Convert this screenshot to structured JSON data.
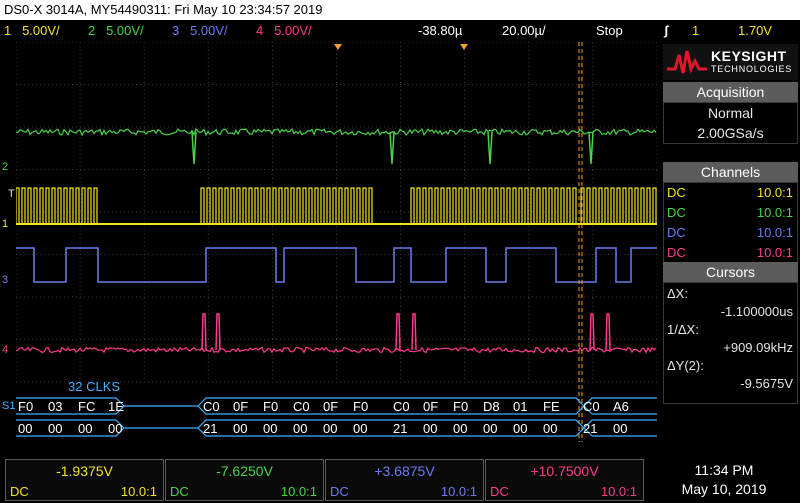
{
  "title": "DS0-X 3014A, MY54490311: Fri May 10 23:34:57 2019",
  "status": {
    "ch1": {
      "num": "1",
      "scale": "5.00V/"
    },
    "ch2": {
      "num": "2",
      "scale": "5.00V/"
    },
    "ch3": {
      "num": "3",
      "scale": "5.00V/"
    },
    "ch4": {
      "num": "4",
      "scale": "5.00V/"
    },
    "delay": "-38.80µ",
    "timebase": "20.00µ/",
    "run_state": "Stop",
    "trigger_icon": "rising-edge-trigger-icon",
    "trigger_source": "1",
    "trigger_level": "1.70V"
  },
  "brand": {
    "name": "KEYSIGHT",
    "sub": "TECHNOLOGIES"
  },
  "acquisition": {
    "header": "Acquisition",
    "mode": "Normal",
    "rate": "2.00GSa/s"
  },
  "channels": {
    "header": "Channels",
    "rows": [
      {
        "coupling": "DC",
        "probe": "10.0:1",
        "color": "#f2e321"
      },
      {
        "coupling": "DC",
        "probe": "10.0:1",
        "color": "#4ad44a"
      },
      {
        "coupling": "DC",
        "probe": "10.0:1",
        "color": "#6b7cf0"
      },
      {
        "coupling": "DC",
        "probe": "10.0:1",
        "color": "#ff3a8c"
      }
    ]
  },
  "cursors": {
    "header": "Cursors",
    "dx_label": "ΔX:",
    "dx_value": "-1.100000us",
    "inv_label": "1/ΔX:",
    "inv_value": "+909.09kHz",
    "dy_label": "ΔY(2):",
    "dy_value": "-9.5675V"
  },
  "plot": {
    "ch_markers": [
      "2",
      "1",
      "3",
      "4"
    ],
    "trigger_marker": "T",
    "serial_marker": "S1",
    "clks_label": "32  CLKS",
    "serial_row1": [
      "F0",
      "03",
      "FC",
      "1E",
      "C0",
      "0F",
      "F0",
      "C0",
      "0F",
      "F0",
      "C0",
      "0F",
      "F0",
      "D8",
      "01",
      "FE",
      "C0",
      "A6"
    ],
    "serial_row2": [
      "00",
      "00",
      "00",
      "00",
      "21",
      "00",
      "00",
      "00",
      "00",
      "00",
      "21",
      "00",
      "00",
      "00",
      "00",
      "00",
      "21",
      "00"
    ]
  },
  "bottom": {
    "cells": [
      {
        "value": "-1.9375V",
        "coupling": "DC",
        "probe": "10.0:1",
        "color": "#f2e321"
      },
      {
        "value": "-7.6250V",
        "coupling": "DC",
        "probe": "10.0:1",
        "color": "#4ad44a"
      },
      {
        "value": "+3.6875V",
        "coupling": "DC",
        "probe": "10.0:1",
        "color": "#6b7cf0"
      },
      {
        "value": "+10.7500V",
        "coupling": "DC",
        "probe": "10.0:1",
        "color": "#ff3a8c"
      }
    ],
    "time": "11:34 PM",
    "date": "May 10, 2019"
  },
  "colors": {
    "ch1": "#f2e321",
    "ch2": "#4ad44a",
    "ch3": "#6b7cf0",
    "ch4": "#ff3a8c",
    "grid": "#3a3a3a",
    "cursor": "#f0a030",
    "serial": "#3fb0ff"
  }
}
